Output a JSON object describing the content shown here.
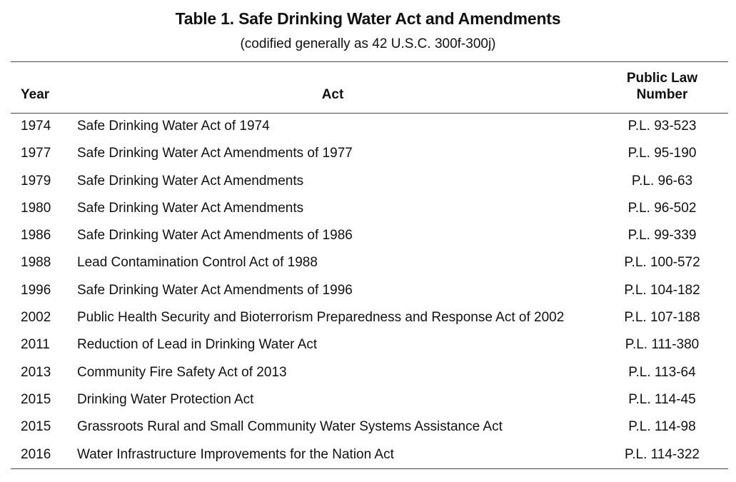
{
  "title": "Table 1. Safe Drinking Water Act and Amendments",
  "subtitle": "(codified generally as 42 U.S.C. 300f-300j)",
  "headers": {
    "year": "Year",
    "act": "Act",
    "public_law_line1": "Public Law",
    "public_law_line2": "Number"
  },
  "rows": [
    {
      "year": "1974",
      "act": "Safe Drinking Water Act of 1974",
      "pl": "P.L. 93-523"
    },
    {
      "year": "1977",
      "act": "Safe Drinking Water Act Amendments of 1977",
      "pl": "P.L. 95-190"
    },
    {
      "year": "1979",
      "act": "Safe Drinking Water Act Amendments",
      "pl": "P.L. 96-63"
    },
    {
      "year": "1980",
      "act": "Safe Drinking Water Act Amendments",
      "pl": "P.L. 96-502"
    },
    {
      "year": "1986",
      "act": "Safe Drinking Water Act Amendments of 1986",
      "pl": "P.L. 99-339"
    },
    {
      "year": "1988",
      "act": "Lead Contamination Control Act of 1988",
      "pl": "P.L. 100-572"
    },
    {
      "year": "1996",
      "act": "Safe Drinking Water Act Amendments of 1996",
      "pl": "P.L. 104-182"
    },
    {
      "year": "2002",
      "act": "Public Health Security and Bioterrorism Preparedness and Response Act of 2002",
      "pl": "P.L. 107-188"
    },
    {
      "year": "2011",
      "act": "Reduction of Lead in Drinking Water Act",
      "pl": "P.L. 111-380"
    },
    {
      "year": "2013",
      "act": "Community Fire Safety Act of 2013",
      "pl": "P.L. 113-64"
    },
    {
      "year": "2015",
      "act": "Drinking Water Protection Act",
      "pl": "P.L. 114-45"
    },
    {
      "year": "2015",
      "act": "Grassroots Rural and Small Community Water Systems Assistance Act",
      "pl": "P.L. 114-98"
    },
    {
      "year": "2016",
      "act": "Water Infrastructure Improvements for the Nation Act",
      "pl": "P.L. 114-322"
    }
  ]
}
